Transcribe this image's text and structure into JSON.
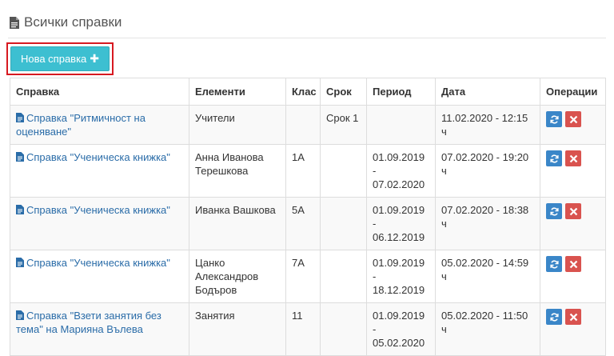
{
  "page": {
    "title": "Всички справки"
  },
  "new_button": {
    "label": "Нова справка",
    "plus": "✚"
  },
  "table": {
    "headers": [
      "Справка",
      "Елементи",
      "Клас",
      "Срок",
      "Период",
      "Дата",
      "Операции"
    ],
    "rows": [
      {
        "report": "Справка \"Ритмичност на оценяване\"",
        "elements": "Учители",
        "class": "",
        "term": "Срок 1",
        "period": "",
        "date": "11.02.2020 - 12:15 ч"
      },
      {
        "report": "Справка \"Ученическа книжка\"",
        "elements": "Анна Иванова Терешкова",
        "class": "1А",
        "term": "",
        "period": "01.09.2019 - 07.02.2020",
        "date": "07.02.2020 - 19:20 ч"
      },
      {
        "report": "Справка \"Ученическа книжка\"",
        "elements": "Иванка Вашкова",
        "class": "5А",
        "term": "",
        "period": "01.09.2019 - 06.12.2019",
        "date": "07.02.2020 - 18:38 ч"
      },
      {
        "report": "Справка \"Ученическа книжка\"",
        "elements": "Цанко Александров Бодъров",
        "class": "7А",
        "term": "",
        "period": "01.09.2019 - 18.12.2019",
        "date": "05.02.2020 - 14:59 ч"
      },
      {
        "report": "Справка \"Взети занятия без тема\" на Марияна Вълева",
        "elements": "Занятия",
        "class": "11",
        "term": "",
        "period": "01.09.2019 - 05.02.2020",
        "date": "05.02.2020 - 11:50 ч"
      }
    ]
  },
  "colors": {
    "button": "#3dbfd1",
    "highlight": "#d71920",
    "refresh": "#3a86c8",
    "delete": "#d9534f",
    "link": "#2a6ca8"
  }
}
